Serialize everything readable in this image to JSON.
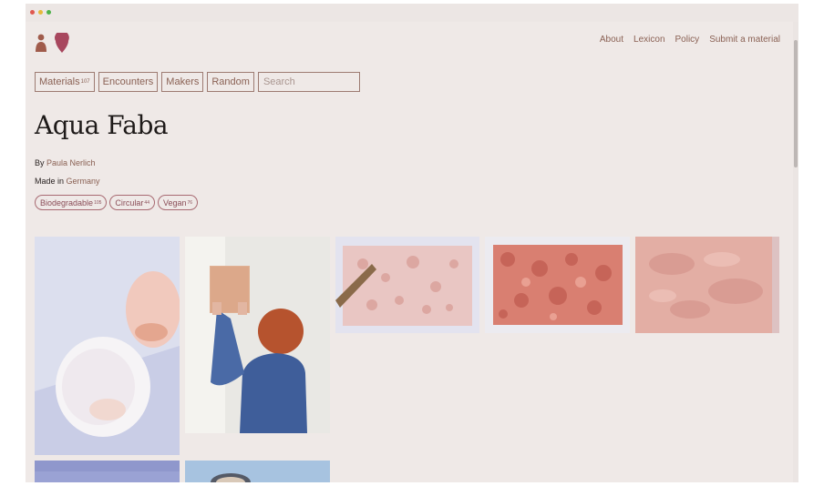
{
  "nav": {
    "links": [
      {
        "label": "About"
      },
      {
        "label": "Lexicon"
      },
      {
        "label": "Policy"
      },
      {
        "label": "Submit a material"
      }
    ]
  },
  "tabs": [
    {
      "label": "Materials",
      "count": "107"
    },
    {
      "label": "Encounters"
    },
    {
      "label": "Makers"
    },
    {
      "label": "Random"
    }
  ],
  "search": {
    "placeholder": "Search"
  },
  "material": {
    "title": "Aqua Faba",
    "by_label": "By",
    "author": "Paula Nerlich",
    "made_in_label": "Made in",
    "country": "Germany",
    "tags": [
      {
        "label": "Biodegradable",
        "count": "105"
      },
      {
        "label": "Circular",
        "count": "44"
      },
      {
        "label": "Vegan",
        "count": "76"
      }
    ]
  },
  "gallery": {
    "images": [
      {
        "subject": "translucent pink bowls"
      },
      {
        "subject": "person holding sheet"
      },
      {
        "subject": "pink textured sheet with stick"
      },
      {
        "subject": "mottled red sheet"
      },
      {
        "subject": "pink wrinkled sheet"
      },
      {
        "subject": "blue surface"
      },
      {
        "subject": "blue surface with object"
      }
    ]
  },
  "colors": {
    "background": "#efe9e7",
    "accent": "#8a6154",
    "tag": "#a86a72"
  }
}
